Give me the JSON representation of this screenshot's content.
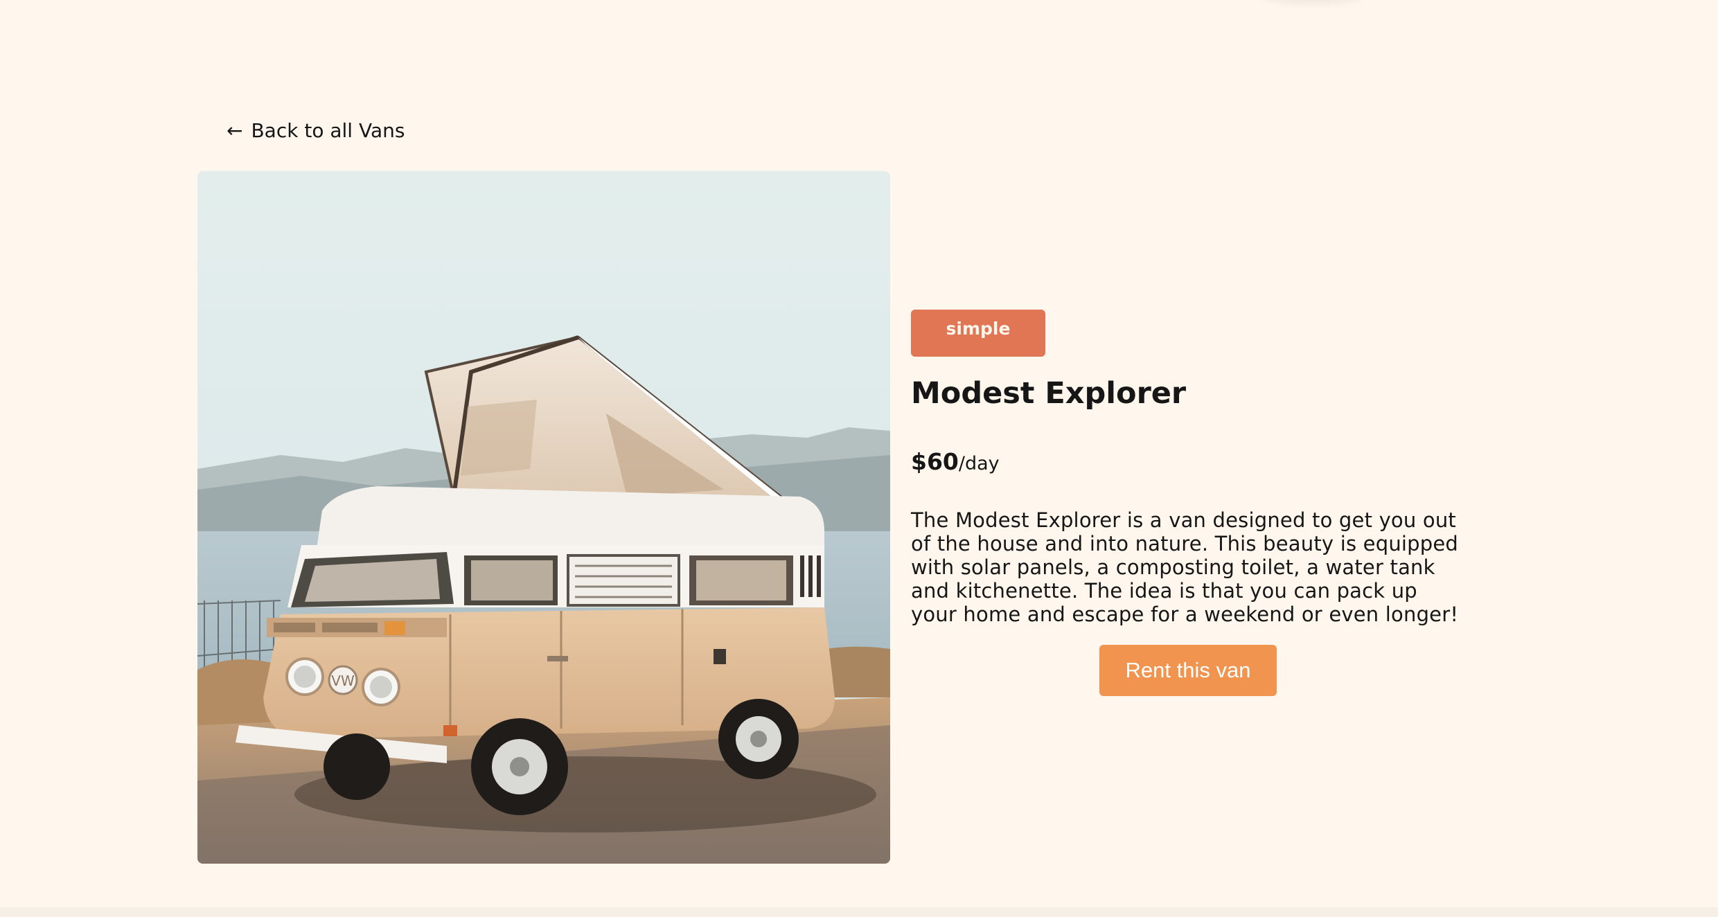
{
  "nav": {
    "back_arrow": "←",
    "back_label": "Back to all Vans"
  },
  "van": {
    "type": "simple",
    "name": "Modest Explorer",
    "price": "$60",
    "price_unit": "/day",
    "description": "The Modest Explorer is a van designed to get you out of the house and into nature. This beauty is equipped with solar panels, a composting toilet, a water tank and kitchenette. The idea is that you can pack up your home and escape for a weekend or even longer!",
    "image_icon": "van-photo"
  },
  "actions": {
    "rent_label": "Rent this van"
  },
  "colors": {
    "background": "#FFF7ED",
    "badge_simple": "#E17654",
    "rent_button": "#F1944F",
    "text": "#161616"
  }
}
